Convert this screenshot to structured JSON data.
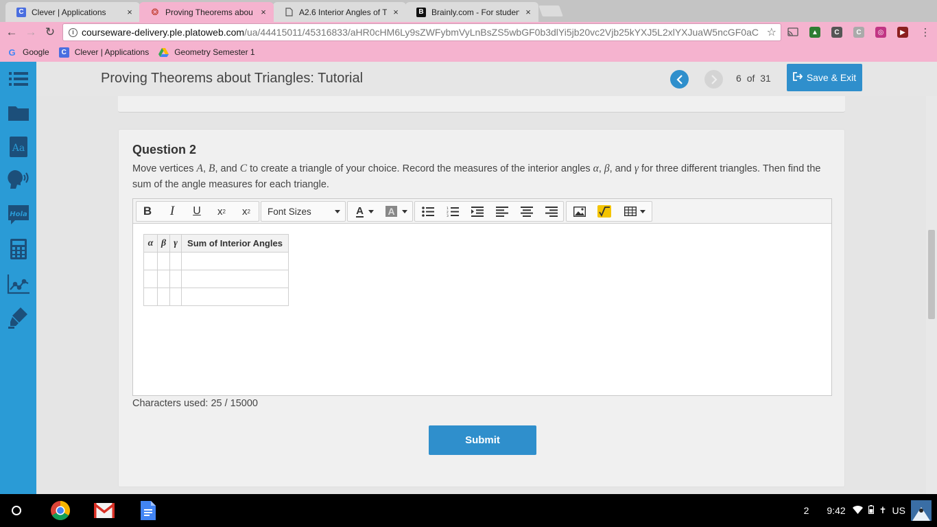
{
  "browser": {
    "tabs": [
      {
        "label": "Clever | Applications",
        "active": false
      },
      {
        "label": "Proving Theorems abou",
        "active": true
      },
      {
        "label": "A2.6 Interior Angles of T",
        "active": false
      },
      {
        "label": "Brainly.com - For studen",
        "active": false
      }
    ],
    "tab_close": "×",
    "url_domain": "courseware-delivery.ple.platoweb.com",
    "url_path": "/ua/44415011/45316833/aHR0cHM6Ly9sZWFybmVyLnBsZS5wbGF0b3dlYi5jb20vc2Vjb25kYXJ5L2xlYXJuaW5ncGF0aC",
    "bookmarks": [
      {
        "label": "Google"
      },
      {
        "label": "Clever | Applications"
      },
      {
        "label": "Geometry Semester 1"
      }
    ]
  },
  "app": {
    "title": "Proving Theorems about Triangles: Tutorial",
    "page_current": "6",
    "page_of": "of",
    "page_total": "31",
    "save_exit_label": "Save & Exit"
  },
  "question": {
    "title": "Question 2",
    "text_part1": "Move vertices ",
    "vertex_a": "A",
    "sep1": ", ",
    "vertex_b": "B",
    "sep2": ", and ",
    "vertex_c": "C",
    "text_part2": " to create a triangle of your choice. Record the measures of the interior angles ",
    "angle_alpha": "α",
    "sep3": ", ",
    "angle_beta": "β",
    "sep4": ", and ",
    "angle_gamma": "γ",
    "text_part3": " for three different triangles. Then find the sum of the angle measures for each triangle."
  },
  "editor": {
    "font_sizes_label": "Font Sizes",
    "table": {
      "headers": [
        "α",
        "β",
        "γ",
        "Sum of Interior Angles"
      ],
      "rows": [
        [
          "",
          "",
          "",
          ""
        ],
        [
          "",
          "",
          "",
          ""
        ],
        [
          "",
          "",
          "",
          ""
        ]
      ]
    },
    "characters_used": "Characters used: 25 / 15000"
  },
  "submit_label": "Submit",
  "shelf": {
    "notifications": "2",
    "time": "9:42",
    "locale": "US"
  },
  "colors": {
    "browser_theme": "#f5b3cf",
    "sidebar": "#2a9bd6",
    "accent_button": "#2f8fcc"
  }
}
